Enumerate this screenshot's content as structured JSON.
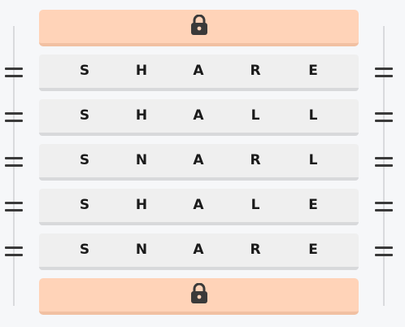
{
  "colors": {
    "background": "#f6f7f9",
    "lock_bar": "#ffd3b8",
    "word_row": "#efefef",
    "rail": "#d9dadd",
    "handle": "#3a3a3a",
    "lock_icon": "#3a3a3a",
    "letter": "#1a1a1a"
  },
  "top_lock": {
    "icon": "lock-icon"
  },
  "bottom_lock": {
    "icon": "lock-icon"
  },
  "rows": [
    {
      "letters": [
        "S",
        "H",
        "A",
        "R",
        "E"
      ]
    },
    {
      "letters": [
        "S",
        "H",
        "A",
        "L",
        "L"
      ]
    },
    {
      "letters": [
        "S",
        "N",
        "A",
        "R",
        "L"
      ]
    },
    {
      "letters": [
        "S",
        "H",
        "A",
        "L",
        "E"
      ]
    },
    {
      "letters": [
        "S",
        "N",
        "A",
        "R",
        "E"
      ]
    }
  ]
}
